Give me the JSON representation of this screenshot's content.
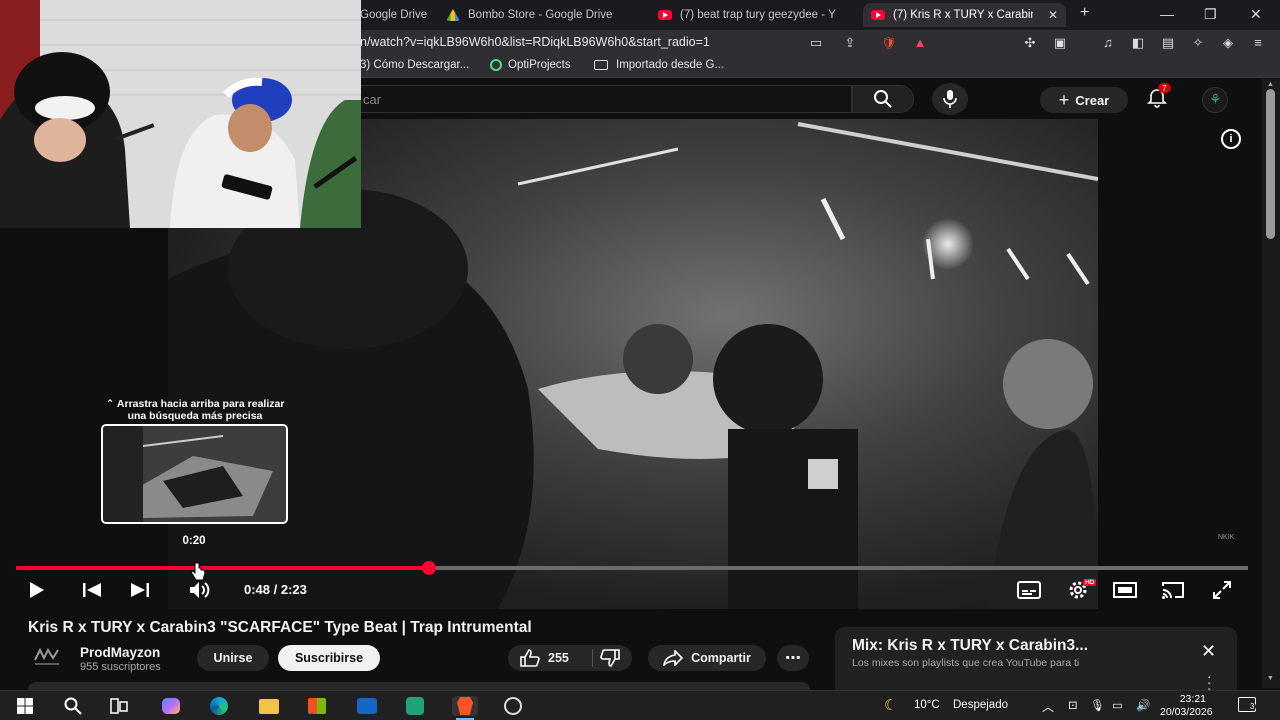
{
  "browser": {
    "tabs": [
      {
        "label": "Google Drive",
        "icon": "google-drive-icon"
      },
      {
        "label": "Bombo Store - Google Drive",
        "icon": "google-drive-icon"
      },
      {
        "label": "(7) beat trap tury geezydee - Y",
        "icon": "youtube-icon"
      },
      {
        "label": "(7) Kris R x TURY x Carabin",
        "icon": "youtube-icon",
        "active": true
      }
    ],
    "new_tab": "+",
    "url": "n/watch?v=iqkLB96W6h0&list=RDiqkLB96W6h0&start_radio=1",
    "brave_badge": "67",
    "bookmarks": [
      {
        "label": "3) Cómo Descargar...",
        "icon": "youtube-icon"
      },
      {
        "label": "OptiProjects",
        "icon": "optiprojects-icon"
      },
      {
        "label": "Importado desde G...",
        "icon": "folder-icon"
      }
    ]
  },
  "youtube": {
    "search_placeholder": "car",
    "create_label": "Crear",
    "notification_count": "7",
    "player": {
      "current_time": "0:48",
      "duration": "2:23",
      "time_display": "0:48 / 2:23",
      "progress_fraction": 0.335,
      "hover_time": "0:20",
      "hover_fraction": 0.14,
      "hint": "Arrastra hacia arriba para realizar una búsqueda más precisa",
      "hint_prefix": "⌃",
      "settings_badge": "HD",
      "watermark": "NKIK"
    },
    "video_title": "Kris R x TURY x Carabin3 \"SCARFACE\" Type Beat | Trap Intrumental",
    "channel": {
      "name": "ProdMayzon",
      "subscribers": "955 suscriptores",
      "join_label": "Unirse",
      "subscribe_label": "Suscribirse"
    },
    "likes": "255",
    "share_label": "Compartir",
    "more_label": "⋯",
    "mix": {
      "title": "Mix: Kris R x TURY x Carabin3...",
      "subtitle": "Los mixes son playlists que crea YouTube para ti"
    }
  },
  "taskbar": {
    "weather_temp": "10°C",
    "weather_desc": "Despejado",
    "time": "23:21",
    "date": "20/03/2026",
    "notification_count": "3"
  },
  "colors": {
    "accent": "#ff0033",
    "background": "#0f0f0f",
    "chrome_bg": "#2e2e33",
    "taskbar_bg": "#202020"
  }
}
